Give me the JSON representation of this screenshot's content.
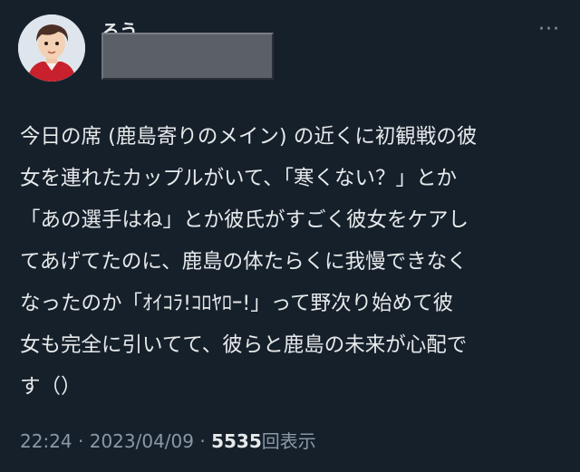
{
  "user": {
    "name_fragment": "ろう",
    "avatar_icon": "avatar-illustration"
  },
  "header": {
    "more_icon": "···"
  },
  "tweet": {
    "lines": [
      "今日の席 (鹿島寄りのメイン) の近くに初観戦の彼",
      "女を連れたカップルがいて、「寒くない？」とか",
      "「あの選手はね」とか彼氏がすごく彼女をケアし",
      "てあげてたのに、鹿島の体たらくに我慢できなく",
      "なったのか「ｵｲｺﾗ!ｺﾛﾔﾛｰ!」って野次り始めて彼",
      "女も完全に引いてて、彼らと鹿島の未来が心配で",
      "す（）"
    ]
  },
  "meta": {
    "time": "22:24",
    "sep1": " · ",
    "date": "2023/04/09",
    "sep2": " · ",
    "views_count": "5535",
    "views_label": "回表示"
  },
  "colors": {
    "background": "#15202b",
    "text": "#e7e9ea",
    "secondary": "#8b98a5"
  }
}
